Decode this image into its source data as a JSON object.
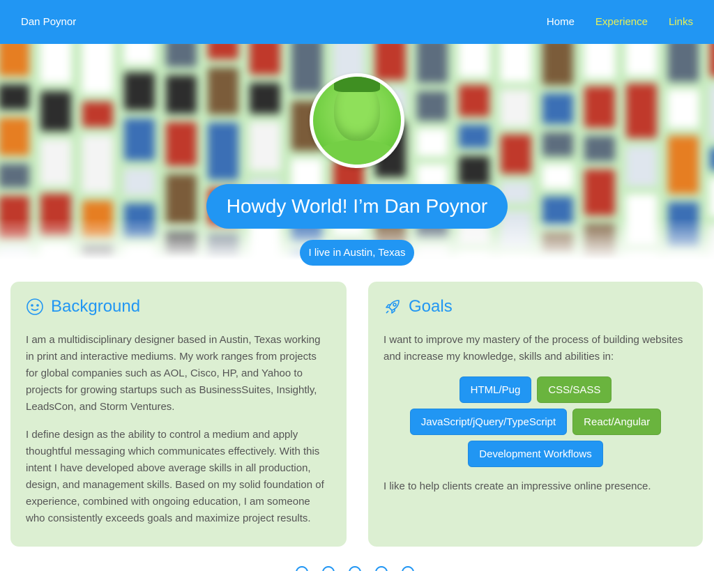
{
  "nav": {
    "brand": "Dan Poynor",
    "links": [
      {
        "label": "Home",
        "active": false
      },
      {
        "label": "Experience",
        "active": true
      },
      {
        "label": "Links",
        "active": true
      }
    ]
  },
  "hero": {
    "headline": "Howdy World! I’m Dan Poynor",
    "subline": "I live in Austin, Texas"
  },
  "background": {
    "title": "Background",
    "icon": "smile-icon",
    "paragraphs": [
      "I am a multidisciplinary designer based in Austin, Texas working in print and interactive mediums. My work ranges from projects for global companies such as AOL, Cisco, HP, and Yahoo to projects for growing startups such as BusinessSuites, Insightly, LeadsCon, and Storm Ventures.",
      "I define design as the ability to control a medium and apply thoughtful messaging which communicates effectively. With this intent I have developed above average skills in all production, design, and management skills. Based on my solid foundation of experience, combined with ongoing education, I am someone who consistently exceeds goals and maximize project results."
    ]
  },
  "goals": {
    "title": "Goals",
    "icon": "rocket-icon",
    "intro": "I want to improve my mastery of the process of building websites and increase my knowledge, skills and abilities in:",
    "skills": [
      {
        "label": "HTML/Pug",
        "color": "blue"
      },
      {
        "label": "CSS/SASS",
        "color": "green"
      },
      {
        "label": "JavaScript/jQuery/TypeScript",
        "color": "blue"
      },
      {
        "label": "React/Angular",
        "color": "green"
      },
      {
        "label": "Development Workflows",
        "color": "blue"
      }
    ],
    "outro": "I like to help clients create an impressive online presence."
  },
  "colors": {
    "primary": "#2196f3",
    "accent_link": "#e6f05a",
    "card_bg": "#dcefd2",
    "chip_green": "#6ab43e"
  }
}
